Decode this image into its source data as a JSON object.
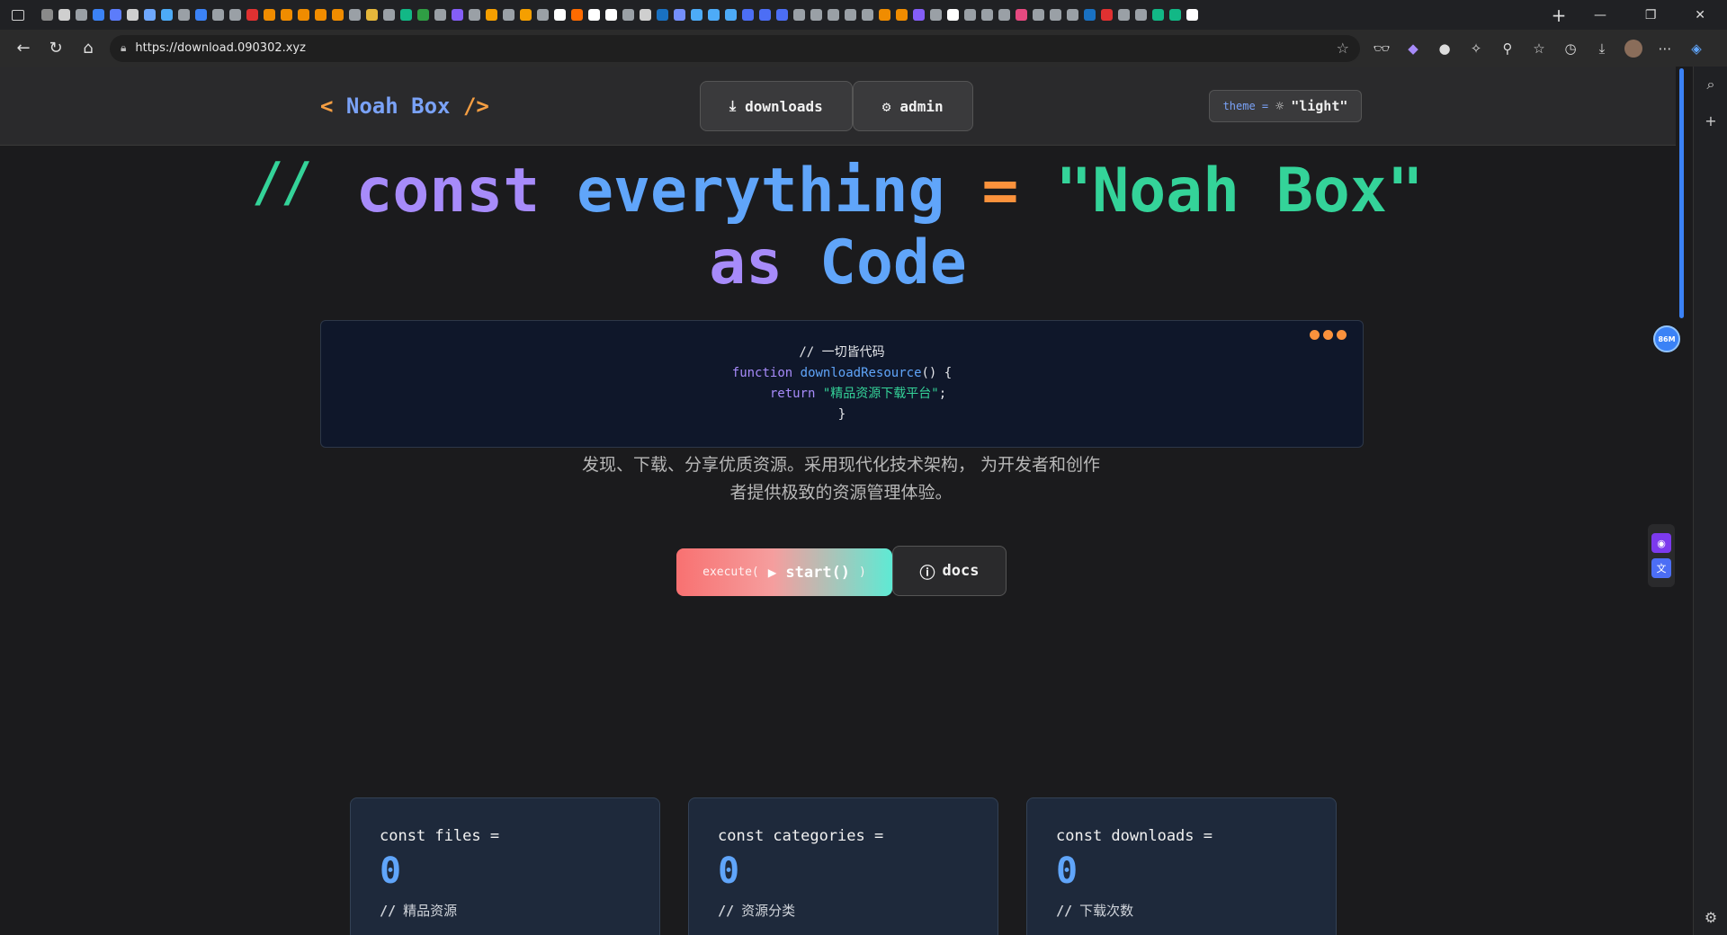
{
  "browser": {
    "url": "https://download.090302.xyz",
    "tab_favicon_colors": [
      "#8a8a8a",
      "#cfcfcf",
      "#9aa0a6",
      "#3b82f6",
      "#5c7cfa",
      "#cfcfcf",
      "#6ea8fe",
      "#4dabf7",
      "#9aa0a6",
      "#3b82f6",
      "#9aa0a6",
      "#9aa0a6",
      "#e03131",
      "#f08c00",
      "#f08c00",
      "#f08c00",
      "#f08c00",
      "#f08c00",
      "#9aa0a6",
      "#e5b73b",
      "#9aa0a6",
      "#12b886",
      "#2f9e44",
      "#9aa0a6",
      "#845ef7",
      "#9aa0a6",
      "#f59f00",
      "#9aa0a6",
      "#f59f00",
      "#9aa0a6",
      "#ffffff",
      "#ff6b00",
      "#ffffff",
      "#ffffff",
      "#9aa0a6",
      "#cfcfcf",
      "#1971c2",
      "#748ffc",
      "#4dabf7",
      "#4dabf7",
      "#4dabf7",
      "#4c6ef5",
      "#4c6ef5",
      "#4c6ef5",
      "#9aa0a6",
      "#9aa0a6",
      "#9aa0a6",
      "#9aa0a6",
      "#9aa0a6",
      "#f08c00",
      "#f08c00",
      "#845ef7",
      "#9aa0a6",
      "#ffffff",
      "#9aa0a6",
      "#9aa0a6",
      "#9aa0a6",
      "#e64980",
      "#9aa0a6",
      "#9aa0a6",
      "#9aa0a6",
      "#1971c2",
      "#e03131",
      "#9aa0a6",
      "#9aa0a6",
      "#12b886",
      "#12b886",
      "#ffffff"
    ]
  },
  "header": {
    "logo_open": "<",
    "logo_name": "Noah Box",
    "logo_close": "/>",
    "nav": {
      "downloads": "downloads",
      "admin": "admin"
    },
    "theme": {
      "key": "theme =",
      "value": "\"light\""
    }
  },
  "hero": {
    "comment": "//",
    "kw_const": "const",
    "identifier": "everything",
    "equals": "=",
    "string": "\"Noah Box\"",
    "kw_as": "as",
    "word_code": "Code"
  },
  "code": {
    "comment": "// 一切皆代码",
    "fn_kw": "function",
    "fn_name": "downloadResource",
    "fn_tail": "() {",
    "ret_kw": "return",
    "ret_str": "\"精品资源下载平台\"",
    "ret_tail": ";",
    "close": "}"
  },
  "description": "发现、下载、分享优质资源。采用现代化技术架构， 为开发者和创作者提供极致的资源管理体验。",
  "actions": {
    "execute_prefix": "execute(",
    "execute_main": "start()",
    "execute_suffix": ")",
    "docs": "docs"
  },
  "stats": [
    {
      "label": "const files =",
      "value": "0",
      "sub": "精品资源"
    },
    {
      "label": "const categories =",
      "value": "0",
      "sub": "资源分类"
    },
    {
      "label": "const downloads =",
      "value": "0",
      "sub": "下载次数"
    }
  ],
  "floating_badge": "86M",
  "colors": {
    "accent_orange": "#fb923c",
    "accent_purple": "#a78bfa",
    "accent_blue": "#60a5fa",
    "accent_green": "#34d399",
    "page_bg": "#1b1b1d",
    "code_bg": "#0f172a"
  }
}
